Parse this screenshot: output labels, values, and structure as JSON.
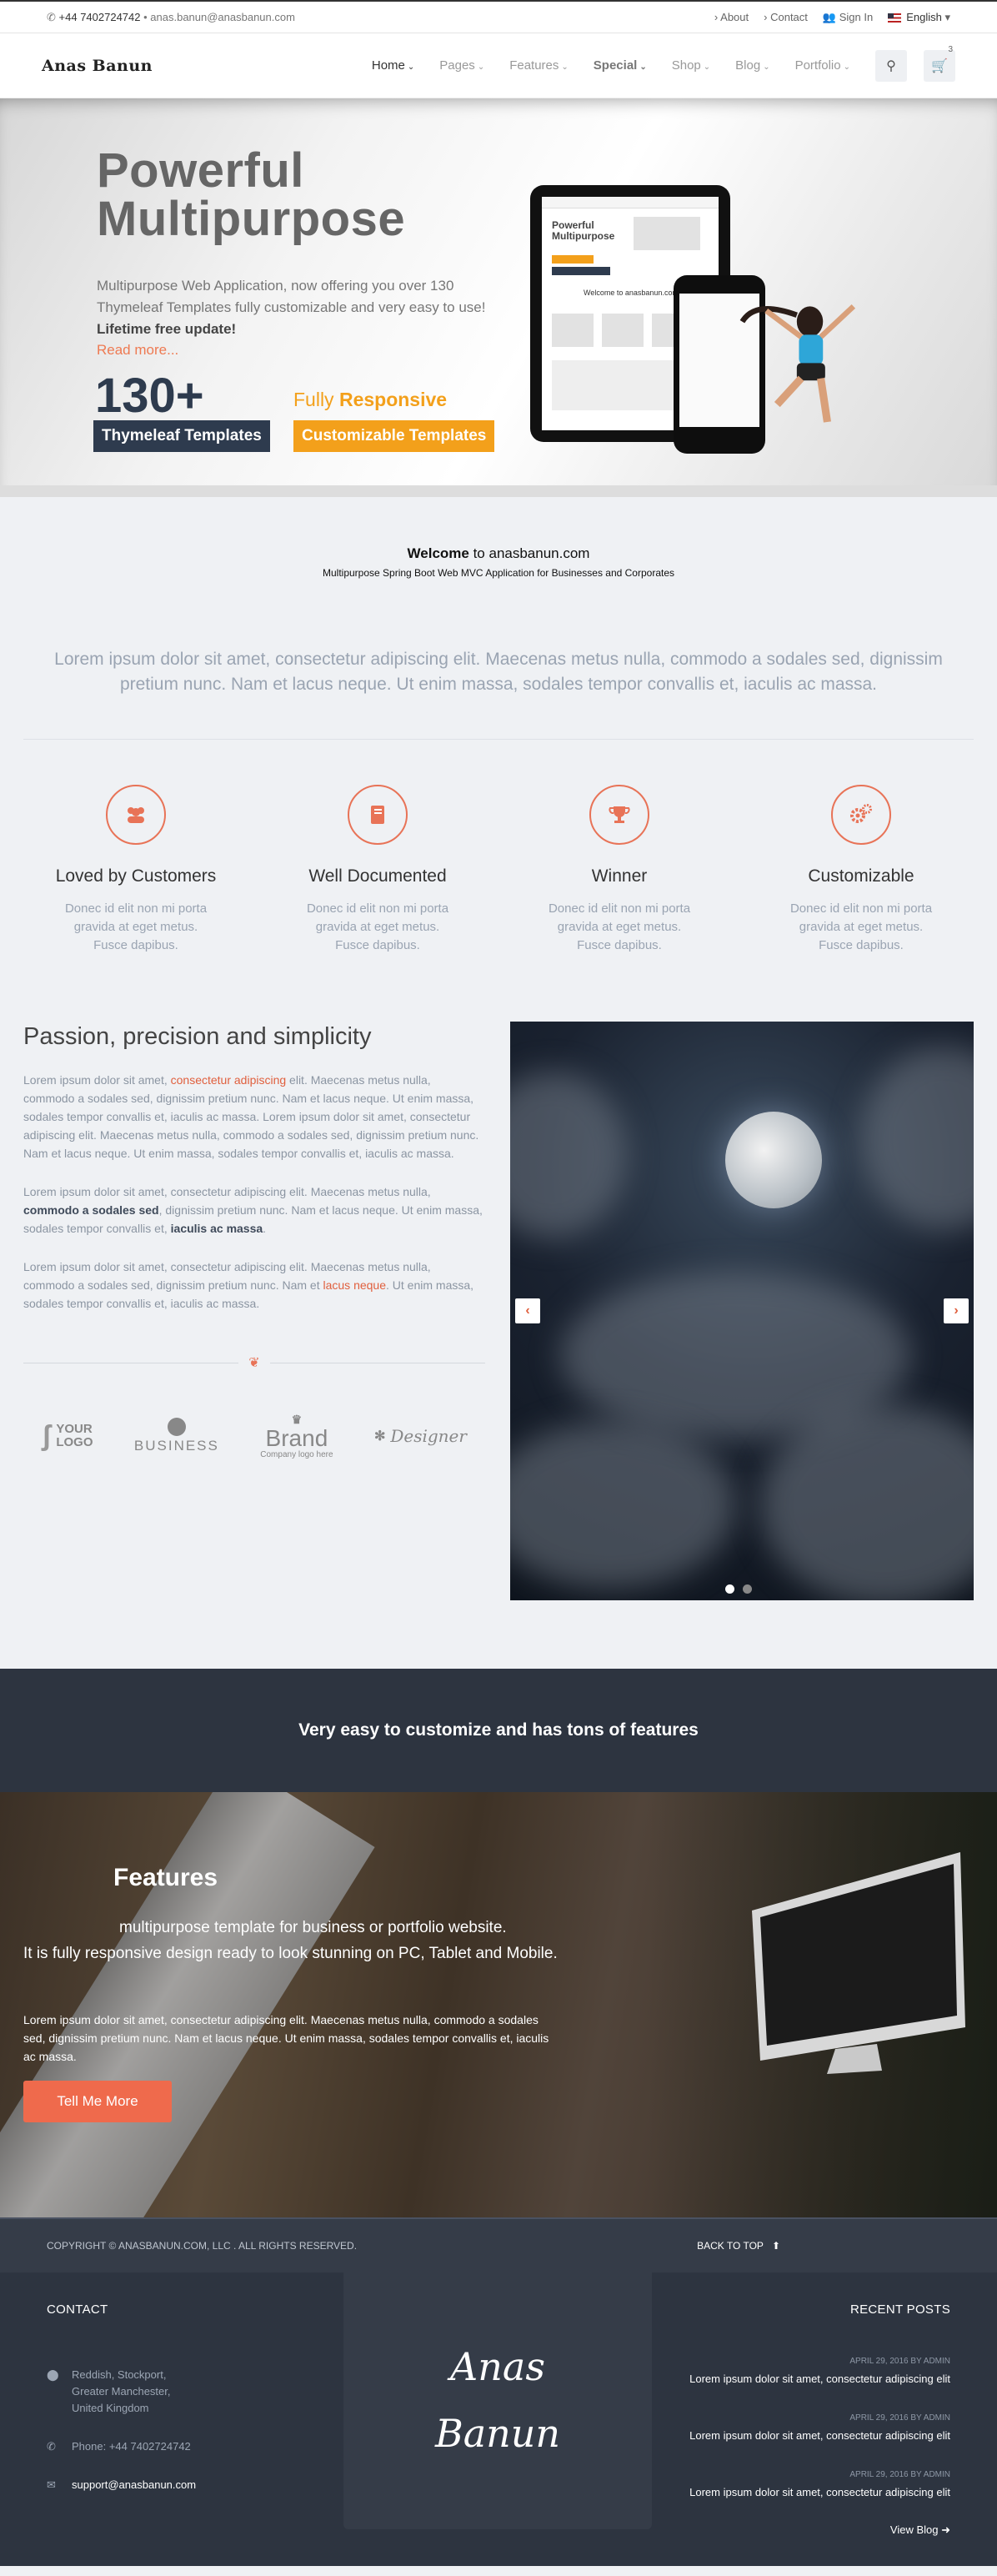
{
  "topbar": {
    "phone": "+44 7402724742",
    "email": "anas.banun@anasbanun.com",
    "about": "About",
    "contact": "Contact",
    "signin": "Sign In",
    "language": "English"
  },
  "nav": {
    "logo": "Anas Banun",
    "items": [
      "Home",
      "Pages",
      "Features",
      "Special",
      "Shop",
      "Blog",
      "Portfolio"
    ],
    "cart_count": "3"
  },
  "hero": {
    "title_line1": "Powerful",
    "title_line2": "Multipurpose",
    "desc": "Multipurpose Web Application, now offering you over 130 Thymeleaf Templates fully customizable and very easy to use!",
    "desc_bold": "Lifetime free update!",
    "readmore": "Read more...",
    "count": "130+",
    "fully": "Fully",
    "responsive": "Responsive",
    "tag1": "Thymeleaf Templates",
    "tag2": "Customizable Templates",
    "tablet_title": "Powerful Multipurpose",
    "tablet_welcome": "Welcome to anasbanun.com"
  },
  "welcome": {
    "bold": "Welcome",
    "rest": " to anasbanun.com",
    "subtitle": "Multipurpose Spring Boot Web MVC Application for Businesses and Corporates"
  },
  "lead": "Lorem ipsum dolor sit amet, consectetur adipiscing elit. Maecenas metus nulla, commodo a sodales sed, dignissim pretium nunc. Nam et lacus neque. Ut enim massa, sodales tempor convallis et, iaculis ac massa.",
  "features": [
    {
      "icon": "users-icon",
      "title": "Loved by Customers",
      "text": "Donec id elit non mi porta gravida at eget metus. Fusce dapibus."
    },
    {
      "icon": "book-icon",
      "title": "Well Documented",
      "text": "Donec id elit non mi porta gravida at eget metus. Fusce dapibus."
    },
    {
      "icon": "trophy-icon",
      "title": "Winner",
      "text": "Donec id elit non mi porta gravida at eget metus. Fusce dapibus."
    },
    {
      "icon": "cogs-icon",
      "title": "Customizable",
      "text": "Donec id elit non mi porta gravida at eget metus. Fusce dapibus."
    }
  ],
  "passion": {
    "title": "Passion, precision and simplicity",
    "p1a": "Lorem ipsum dolor sit amet, ",
    "p1b": "consectetur adipiscing",
    "p1c": " elit. Maecenas metus nulla, commodo a sodales sed, dignissim pretium nunc. Nam et lacus neque. Ut enim massa, sodales tempor convallis et, iaculis ac massa. Lorem ipsum dolor sit amet, consectetur adipiscing elit. Maecenas metus nulla, commodo a sodales sed, dignissim pretium nunc. Nam et lacus neque. Ut enim massa, sodales tempor convallis et, iaculis ac massa.",
    "p2a": "Lorem ipsum dolor sit amet, consectetur adipiscing elit. Maecenas metus nulla, ",
    "p2b": "commodo a sodales sed",
    "p2c": ", dignissim pretium nunc. Nam et lacus neque. Ut enim massa, sodales tempor convallis et, ",
    "p2d": "iaculis ac massa",
    "p2e": ".",
    "p3a": "Lorem ipsum dolor sit amet, consectetur adipiscing elit. Maecenas metus nulla, commodo a sodales sed, dignissim pretium nunc. Nam et ",
    "p3b": "lacus neque",
    "p3c": ". Ut enim massa, sodales tempor convallis et, iaculis ac massa."
  },
  "logos": {
    "l1a": "YOUR",
    "l1b": "LOGO",
    "l2": "BUSINESS",
    "l3a": "Brand",
    "l3b": "Company logo here",
    "l4": "Designer"
  },
  "band": "Very easy to customize and has tons of features",
  "featuresBlock": {
    "title": "Features",
    "sub1": "multipurpose template for business or portfolio website.",
    "sub2": "It is fully responsive design ready to look stunning on PC, Tablet and Mobile.",
    "body": "Lorem ipsum dolor sit amet, consectetur adipiscing elit. Maecenas metus nulla, commodo a sodales sed, dignissim pretium nunc. Nam et lacus neque. Ut enim massa, sodales tempor convallis et, iaculis ac massa.",
    "button": "Tell Me More"
  },
  "copyright": "COPYRIGHT © ANASBANUN.COM, LLC . ALL RIGHTS RESERVED.",
  "backtotop": "BACK TO TOP",
  "footer": {
    "contact_title": "CONTACT",
    "address1": "Reddish, Stockport,",
    "address2": "Greater Manchester,",
    "address3": "United Kingdom",
    "phone": "Phone: +44 7402724742",
    "email": "support@anasbanun.com",
    "logo1": "Anas",
    "logo2": "Banun",
    "recent_title": "RECENT POSTS",
    "posts": [
      {
        "date": "APRIL 29, 2016 BY ADMIN",
        "title": "Lorem ipsum dolor sit amet, consectetur adipiscing elit"
      },
      {
        "date": "APRIL 29, 2016 BY ADMIN",
        "title": "Lorem ipsum dolor sit amet, consectetur adipiscing elit"
      },
      {
        "date": "APRIL 29, 2016 BY ADMIN",
        "title": "Lorem ipsum dolor sit amet, consectetur adipiscing elit"
      }
    ],
    "viewblog": "View Blog"
  },
  "colors": {
    "accent": "#e87357",
    "navy": "#2e3b4e",
    "orange": "#f3a01b",
    "dark": "#2d3440"
  }
}
